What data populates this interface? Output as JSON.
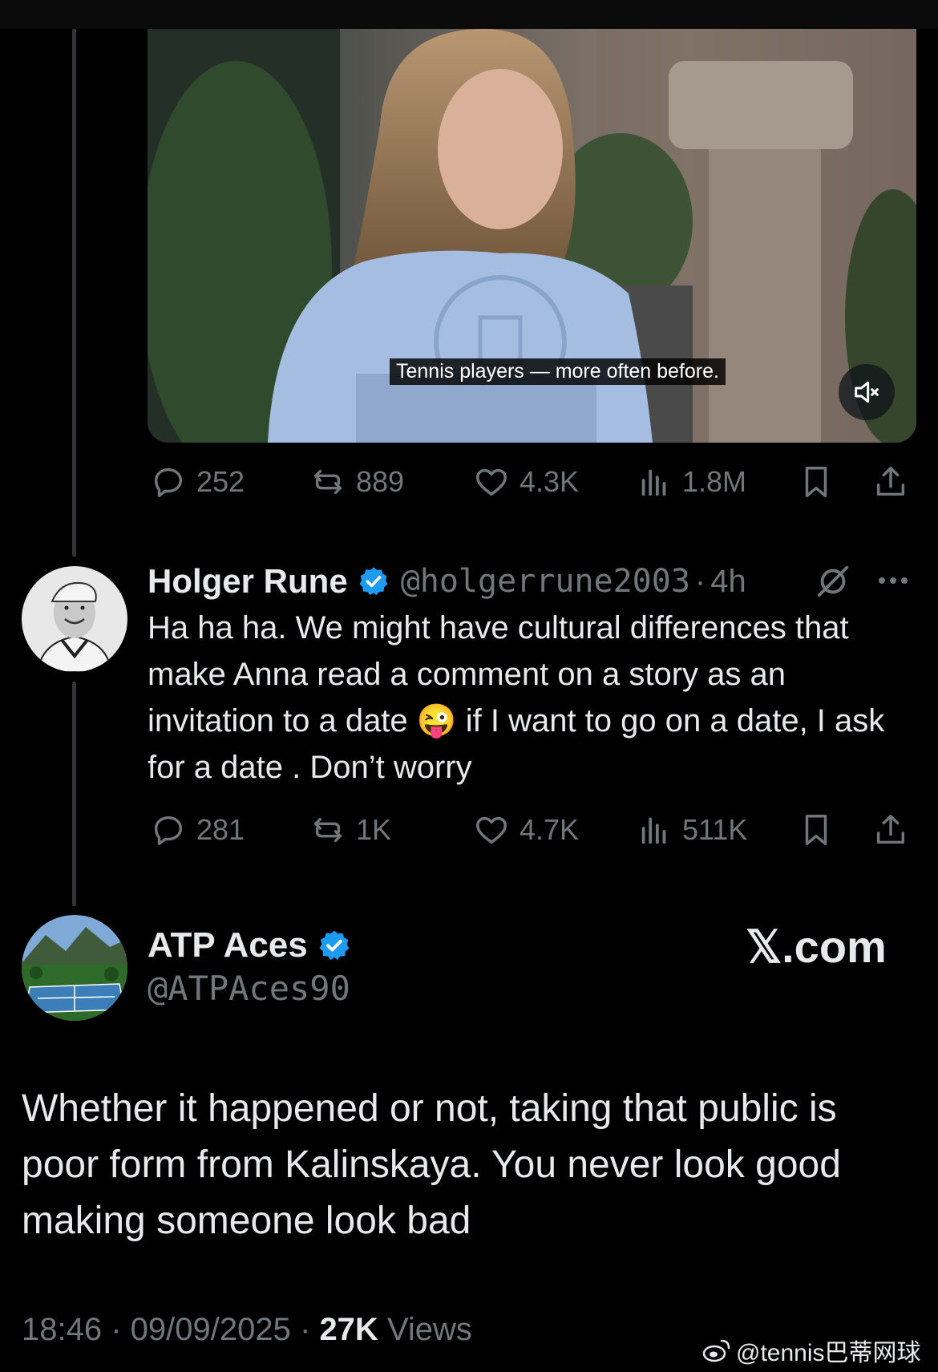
{
  "video": {
    "caption": "Tennis players — more often before.",
    "mute_icon": "speaker-muted-icon"
  },
  "tweet1_stats": {
    "replies": "252",
    "reposts": "889",
    "likes": "4.3K",
    "views": "1.8M"
  },
  "reply": {
    "name": "Holger Rune",
    "handle": "@holgerrune2003",
    "time": "4h",
    "text_before_emoji": "Ha ha ha. We might have cultural differences that make Anna read a comment on a story as an invitation to a date",
    "emoji": "😜",
    "text_after_emoji": " if I want to go on a date, I ask for a date . Don’t worry",
    "stats": {
      "replies": "281",
      "reposts": "1K",
      "likes": "4.7K",
      "views": "511K"
    }
  },
  "quote": {
    "name": "ATP Aces",
    "handle": "@ATPAces90",
    "brand": "𝕏.com",
    "text": "Whether it happened or not, taking that public is poor form from Kalinskaya. You never look good making someone look bad",
    "time": "18:46",
    "date": "09/09/2025",
    "views_count": "27K",
    "views_label": "Views"
  },
  "watermark": "@tennis巴蒂网球",
  "colors": {
    "background": "#000000",
    "text": "#e7e9ea",
    "muted": "#71767b",
    "verified": "#1d9bf0"
  }
}
